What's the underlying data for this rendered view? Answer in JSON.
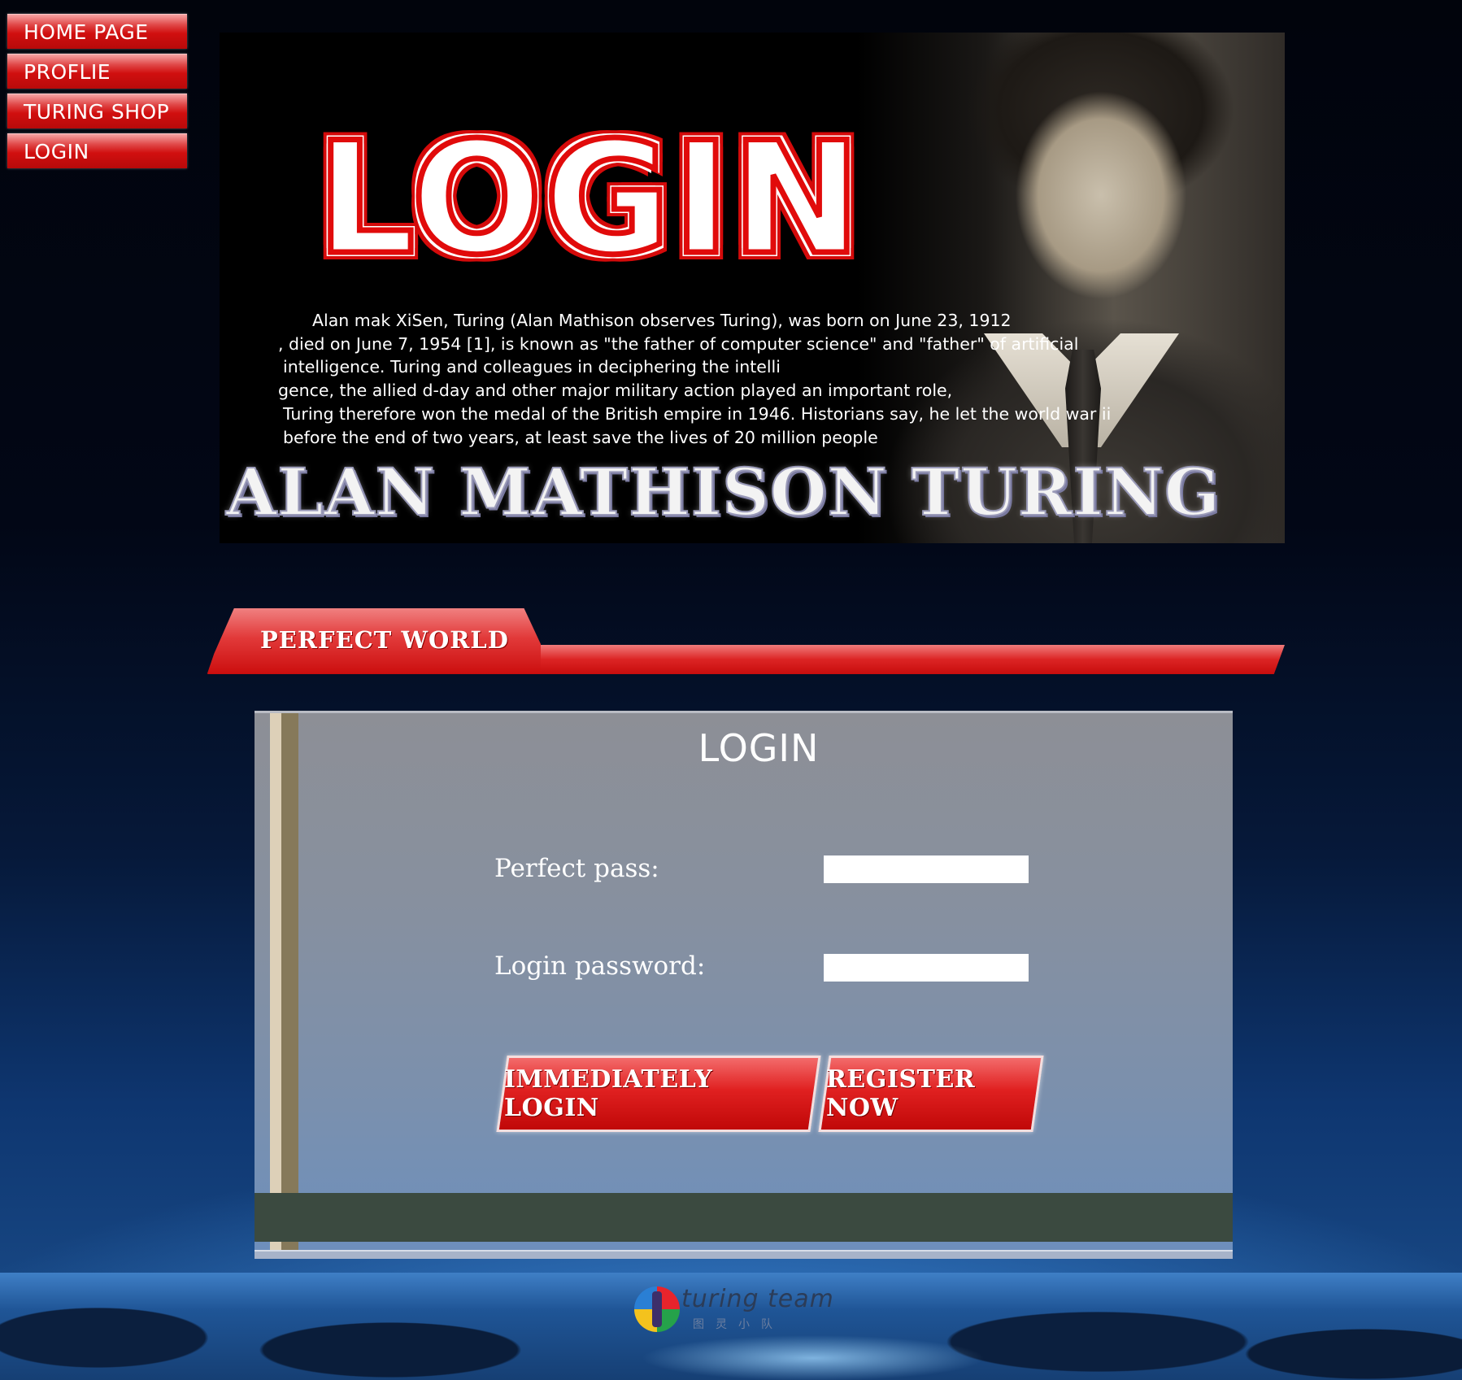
{
  "nav": {
    "items": [
      {
        "label": "HOME PAGE"
      },
      {
        "label": "PROFLIE"
      },
      {
        "label": "TURING SHOP"
      },
      {
        "label": "LOGIN"
      }
    ]
  },
  "banner": {
    "logo_text": "LOGIN",
    "bio_lines": [
      "Alan mak XiSen, Turing (Alan Mathison observes Turing), was born on June 23, 1912",
      ", died on June 7, 1954 [1], is known as \"the father of computer science\" and \"father\" of artificial",
      "intelligence. Turing and colleagues in deciphering the intelli",
      "gence, the allied d-day and other major military action played an important role,",
      "Turing therefore won the medal of the British empire in 1946. Historians say, he let the world war ii",
      "before the end of two years, at least save the lives of 20 million people"
    ],
    "name": "ALAN MATHISON TURING"
  },
  "section": {
    "title": "PERFECT WORLD"
  },
  "login": {
    "title": "LOGIN",
    "pass_label": "Perfect pass:",
    "pass_value": "",
    "password_label": "Login password:",
    "password_value": "",
    "login_button": "IMMEDIATELY LOGIN",
    "register_button": "REGISTER NOW"
  },
  "footer": {
    "brand": "turing  team",
    "sub": "图灵小队"
  },
  "colors": {
    "accent_red": "#d10f0f",
    "panel_footer": "#3b4a40"
  }
}
